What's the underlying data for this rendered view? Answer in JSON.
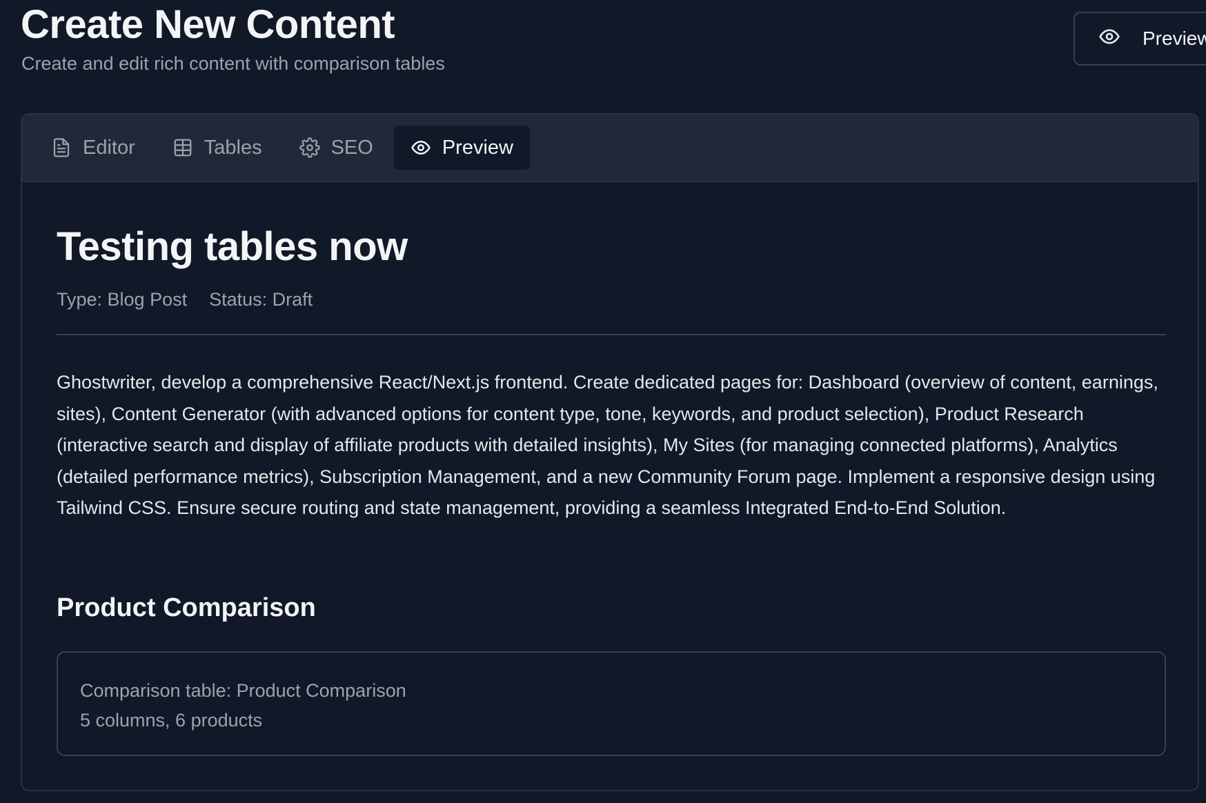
{
  "header": {
    "title": "Create New Content",
    "subtitle": "Create and edit rich content with comparison tables",
    "preview_button": {
      "label": "Preview",
      "icon": "eye-icon"
    }
  },
  "tabs": [
    {
      "label": "Editor",
      "icon": "document-icon",
      "active": false
    },
    {
      "label": "Tables",
      "icon": "table-icon",
      "active": false
    },
    {
      "label": "SEO",
      "icon": "gear-icon",
      "active": false
    },
    {
      "label": "Preview",
      "icon": "eye-icon",
      "active": true
    }
  ],
  "preview": {
    "title": "Testing tables now",
    "type": "Type: Blog Post",
    "status": "Status: Draft",
    "body": "Ghostwriter, develop a comprehensive React/Next.js frontend. Create dedicated pages for: Dashboard (overview of content, earnings, sites), Content Generator (with advanced options for content type, tone, keywords, and product selection), Product Research (interactive search and display of affiliate products with detailed insights), My Sites (for managing connected platforms), Analytics (detailed performance metrics), Subscription Management, and a new Community Forum page. Implement a responsive design using Tailwind CSS. Ensure secure routing and state management, providing a seamless Integrated End-to-End Solution.",
    "section_heading": "Product Comparison",
    "table_placeholder": {
      "title": "Comparison table: Product Comparison",
      "summary": "5 columns, 6 products"
    }
  },
  "colors": {
    "background": "#111827",
    "tabbar": "#1f2937",
    "border": "#374151",
    "text": "#f3f4f6",
    "muted": "#9ca3af"
  }
}
